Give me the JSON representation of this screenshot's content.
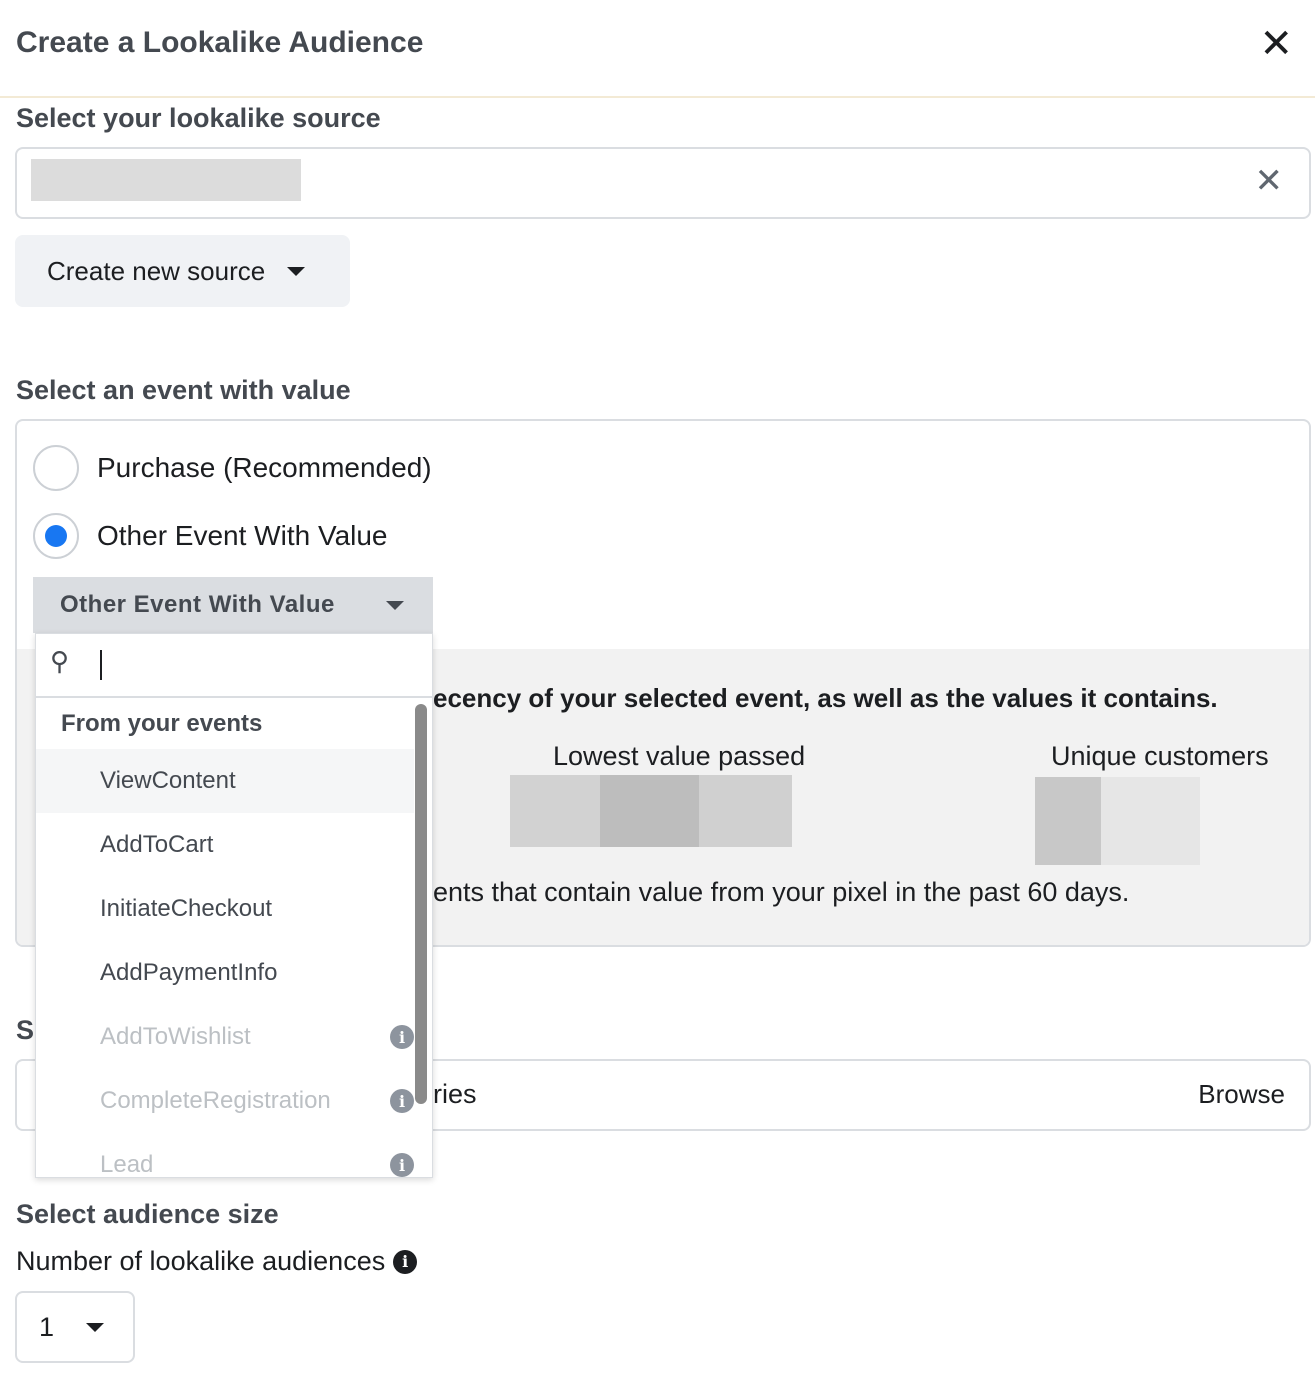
{
  "dialog": {
    "title": "Create a Lookalike Audience",
    "close_icon": "close-icon"
  },
  "source": {
    "heading": "Select your lookalike source",
    "create_button": "Create new source"
  },
  "event": {
    "heading": "Select an event with value",
    "options": [
      {
        "label": "Purchase (Recommended)",
        "selected": false
      },
      {
        "label": "Other Event With Value",
        "selected": true
      }
    ],
    "dropdown_value": "Other Event With Value",
    "search_value": "",
    "group_label": "From your events",
    "items": [
      {
        "label": "ViewContent",
        "enabled": true
      },
      {
        "label": "AddToCart",
        "enabled": true
      },
      {
        "label": "InitiateCheckout",
        "enabled": true
      },
      {
        "label": "AddPaymentInfo",
        "enabled": true
      },
      {
        "label": "AddToWishlist",
        "enabled": false
      },
      {
        "label": "CompleteRegistration",
        "enabled": false
      },
      {
        "label": "Lead",
        "enabled": false
      }
    ],
    "info_text": "ecency of your selected event, as well as the values it contains.",
    "lowest_value_label": "Lowest value passed",
    "unique_customers_label": "Unique customers",
    "footnote": "ents that contain value from your pixel in the past 60 days."
  },
  "location": {
    "heading_partial": "S",
    "input_partial": "ries",
    "browse": "Browse"
  },
  "size": {
    "heading": "Select audience size",
    "number_label": "Number of lookalike audiences",
    "number_value": "1"
  },
  "colors": {
    "accent": "#1877f2",
    "panel": "#f2f2f2"
  }
}
